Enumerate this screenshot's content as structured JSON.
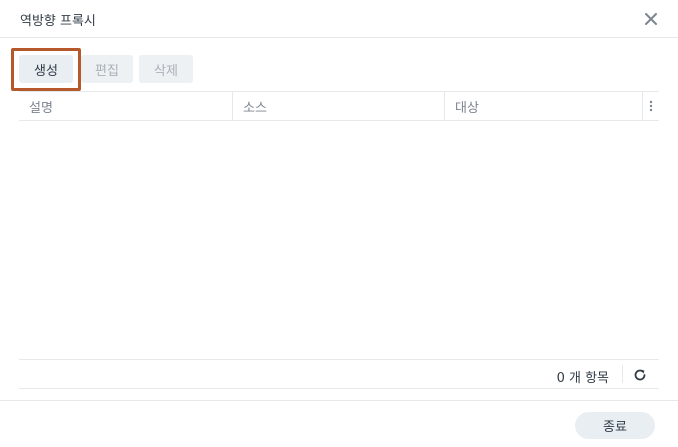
{
  "dialog": {
    "title": "역방향 프록시",
    "close_icon": "close-icon"
  },
  "toolbar": {
    "create_label": "생성",
    "edit_label": "편집",
    "delete_label": "삭제"
  },
  "table": {
    "columns": [
      "설명",
      "소스",
      "대상"
    ],
    "menu_icon": "vertical-ellipsis-icon",
    "rows": []
  },
  "status": {
    "count_text": "0 개 항목",
    "refresh_icon": "refresh-icon"
  },
  "footer": {
    "close_label": "종료"
  },
  "colors": {
    "highlight": "#b5582b",
    "button_bg": "#e9eef3",
    "disabled_text": "#a9b0b9",
    "border": "#e6e9ec"
  }
}
